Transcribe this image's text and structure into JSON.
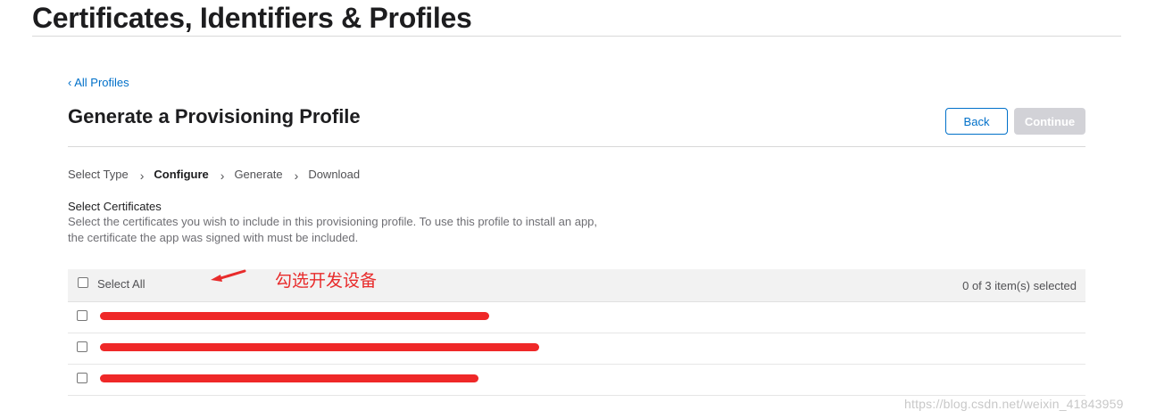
{
  "header": {
    "title": "Certificates, Identifiers & Profiles"
  },
  "nav": {
    "back_link": "‹ All Profiles"
  },
  "section": {
    "title": "Generate a Provisioning Profile",
    "back_button": "Back",
    "continue_button": "Continue"
  },
  "steps": [
    {
      "label": "Select Type"
    },
    {
      "label": "Configure",
      "active": true
    },
    {
      "label": "Generate"
    },
    {
      "label": "Download"
    }
  ],
  "step_separator": "›",
  "certificates": {
    "title": "Select Certificates",
    "description": "Select the certificates you wish to include in this provisioning profile. To use this profile to install an app, the certificate the app was signed with must be included.",
    "select_all_label": "Select All",
    "selected_count": "0 of 3 item(s) selected",
    "rows": [
      {
        "checked": false,
        "redacted": true
      },
      {
        "checked": false,
        "redacted": true
      },
      {
        "checked": false,
        "redacted": true
      }
    ]
  },
  "annotation": {
    "text": "勾选开发设备",
    "color": "#e82b2b"
  },
  "watermark": "https://blog.csdn.net/weixin_41843959",
  "colors": {
    "link": "#0070c9",
    "disabled_button": "#d2d2d7",
    "redaction": "#ee1c1c"
  }
}
